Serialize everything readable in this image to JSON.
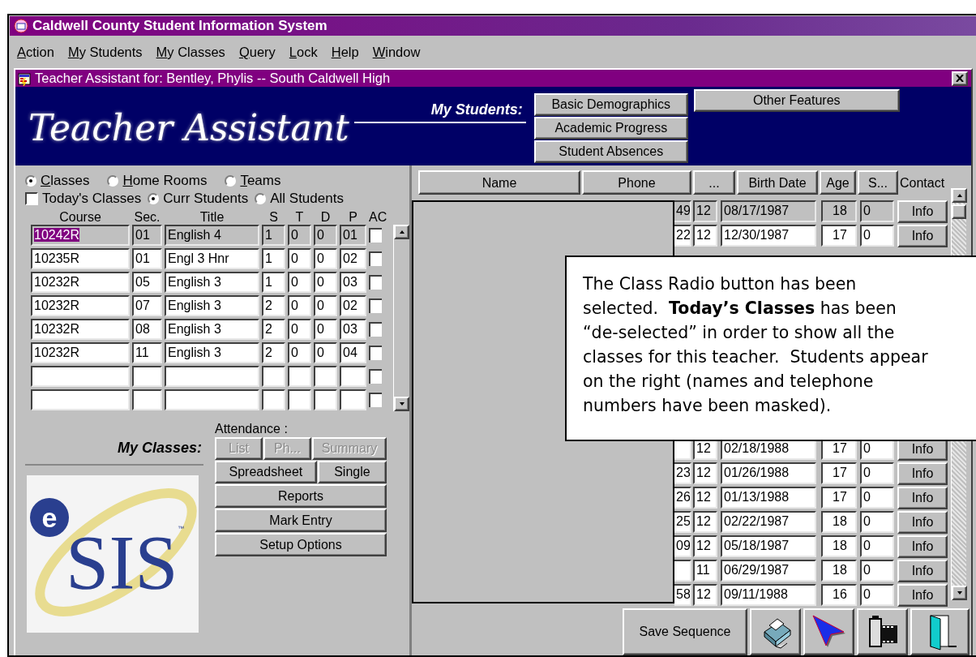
{
  "window": {
    "title": "Caldwell County Student Information System"
  },
  "menu": [
    {
      "key": "A",
      "after": "ction"
    },
    {
      "key": "M",
      "after": "y Students"
    },
    {
      "key": "M",
      "after": "y Classes"
    },
    {
      "key": "Q",
      "after": "uery"
    },
    {
      "key": "L",
      "after": "ock"
    },
    {
      "key": "H",
      "after": "elp"
    },
    {
      "key": "W",
      "after": "indow"
    }
  ],
  "inner_window": {
    "title": "Teacher Assistant for: Bentley, Phylis -- South Caldwell High"
  },
  "banner": {
    "title": "Teacher Assistant",
    "section_label": "My Students:",
    "buttons": [
      "Basic Demographics",
      "Academic Progress",
      "Student Absences"
    ],
    "other_button": "Other Features"
  },
  "group_filter": [
    {
      "key": "C",
      "after": "lasses",
      "selected": true
    },
    {
      "key": "H",
      "after": "ome Rooms",
      "selected": false
    },
    {
      "key": "T",
      "after": "eams",
      "selected": false
    }
  ],
  "todays_classes": {
    "label": "Today's Classes",
    "checked": false
  },
  "student_filter": [
    {
      "label": "Curr Students",
      "selected": true
    },
    {
      "label": "All Students",
      "selected": false
    }
  ],
  "classes_table": {
    "columns": [
      "Course",
      "Sec.",
      "Title",
      "S",
      "T",
      "D",
      "P",
      "AC"
    ],
    "rows": [
      {
        "course": "10242R",
        "sec": "01",
        "title": "English 4",
        "s": "1",
        "t": "0",
        "d": "0",
        "p": "01",
        "ac": false,
        "selected": true
      },
      {
        "course": "10235R",
        "sec": "01",
        "title": "Engl 3 Hnr",
        "s": "1",
        "t": "0",
        "d": "0",
        "p": "02",
        "ac": false,
        "selected": false
      },
      {
        "course": "10232R",
        "sec": "05",
        "title": "English 3",
        "s": "1",
        "t": "0",
        "d": "0",
        "p": "03",
        "ac": false,
        "selected": false
      },
      {
        "course": "10232R",
        "sec": "07",
        "title": "English 3",
        "s": "2",
        "t": "0",
        "d": "0",
        "p": "02",
        "ac": false,
        "selected": false
      },
      {
        "course": "10232R",
        "sec": "08",
        "title": "English 3",
        "s": "2",
        "t": "0",
        "d": "0",
        "p": "03",
        "ac": false,
        "selected": false
      },
      {
        "course": "10232R",
        "sec": "11",
        "title": "English 3",
        "s": "2",
        "t": "0",
        "d": "0",
        "p": "04",
        "ac": false,
        "selected": false
      },
      {
        "ac": false,
        "selected": false
      },
      {
        "ac": false,
        "selected": false
      }
    ]
  },
  "my_classes": {
    "label": "My Classes:"
  },
  "logo": {
    "prefix": "e",
    "name": "SIS",
    "mark": "™"
  },
  "attendance": {
    "label": "Attendance :",
    "button_rows": [
      [
        {
          "label": "List",
          "disabled": true
        },
        {
          "label": "Ph...",
          "disabled": true
        },
        {
          "label": "Summary",
          "disabled": true
        }
      ],
      [
        {
          "label": "Spreadsheet",
          "disabled": false
        },
        {
          "label": "Single",
          "disabled": false
        }
      ]
    ]
  },
  "class_buttons": [
    "Reports",
    "Mark Entry",
    "Setup Options"
  ],
  "students_table": {
    "columns": [
      "Name",
      "Phone",
      "...",
      "Birth Date",
      "Age",
      "S...",
      "Contact"
    ],
    "rows": [
      {
        "phone": "49",
        "grade": "12",
        "birth_date": "08/17/1987",
        "age": "18",
        "s": "0",
        "contact": "Info",
        "selected": true
      },
      {
        "phone": "22",
        "grade": "12",
        "birth_date": "12/30/1987",
        "age": "17",
        "s": "0",
        "contact": "Info",
        "selected": false
      }
    ],
    "lower_rows": [
      {
        "grade": "12",
        "birth_date": "02/18/1988",
        "age": "17",
        "s": "0",
        "contact": "Info",
        "selected": false
      },
      {
        "phone": "23",
        "grade": "12",
        "birth_date": "01/26/1988",
        "age": "17",
        "s": "0",
        "contact": "Info",
        "selected": false
      },
      {
        "phone": "26",
        "grade": "12",
        "birth_date": "01/13/1988",
        "age": "17",
        "s": "0",
        "contact": "Info",
        "selected": false
      },
      {
        "phone": "25",
        "grade": "12",
        "birth_date": "02/22/1987",
        "age": "18",
        "s": "0",
        "contact": "Info",
        "selected": false
      },
      {
        "phone": "09",
        "grade": "12",
        "birth_date": "05/18/1987",
        "age": "18",
        "s": "0",
        "contact": "Info",
        "selected": false
      },
      {
        "grade": "11",
        "birth_date": "06/29/1987",
        "age": "18",
        "s": "0",
        "contact": "Info",
        "selected": false
      },
      {
        "phone": "58",
        "grade": "12",
        "birth_date": "09/11/1988",
        "age": "16",
        "s": "0",
        "contact": "Info",
        "selected": false
      }
    ]
  },
  "callout": {
    "text": "The Class Radio button has been\nselected.  **Today’s Classes** has been\n“de-selected” in order to show all the\nclasses for this teacher.  Students appear\non the right (names and telephone\nnumbers have been masked)."
  },
  "footer": {
    "save_button": "Save Sequence"
  }
}
